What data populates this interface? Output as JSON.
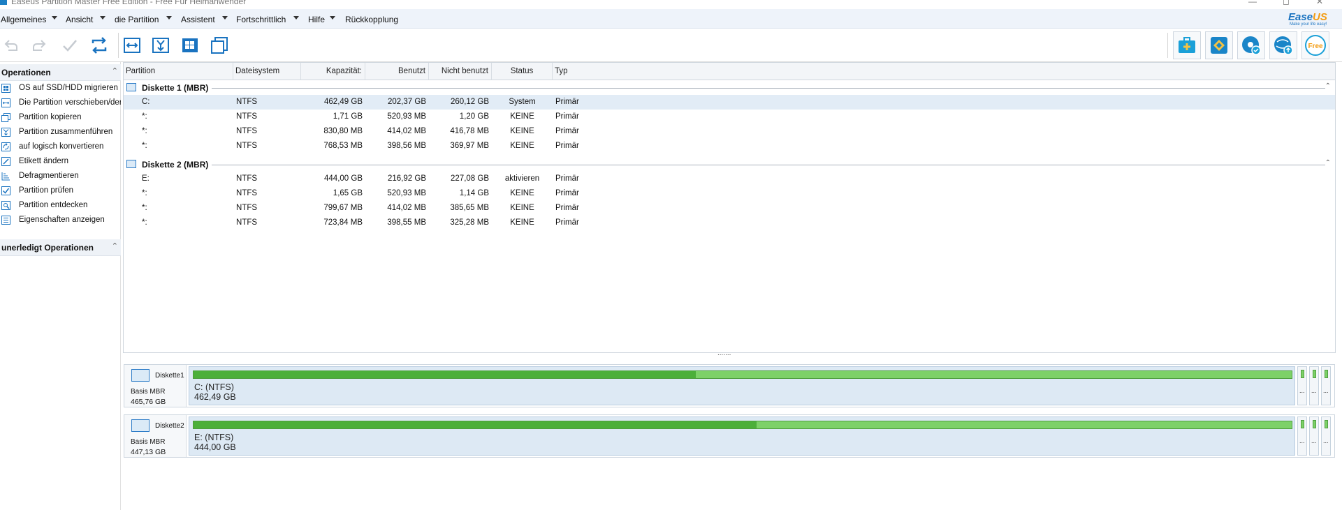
{
  "window": {
    "title": "Easeus Partition Master Free Edition - Free Für Heimanwender",
    "minimize": "—",
    "maximize": "◻",
    "close": "✕"
  },
  "menu": [
    "Allgemeines",
    "Ansicht",
    "die Partition",
    "Assistent",
    "Fortschrittlich",
    "Hilfe",
    "Rückkopplung"
  ],
  "logo": {
    "brand": "Ease",
    "brand_accent": "US",
    "tagline": "Make your life easy!"
  },
  "toolbar": {
    "left_icons": [
      "undo-icon",
      "redo-icon",
      "apply-icon",
      "refresh-icon"
    ],
    "mid_icons": [
      "resize-move-icon",
      "merge-icon",
      "migrate-os-icon",
      "copy-icon"
    ],
    "right_icons": [
      "backup-icon",
      "tag-icon",
      "recovery-icon",
      "update-icon",
      "free-icon"
    ],
    "free_label": "Free"
  },
  "operations": {
    "title": "Operationen",
    "collapse": "⌃",
    "items": [
      {
        "label": "OS auf SSD/HDD migrieren",
        "icon": "migrate-os-icon"
      },
      {
        "label": "Die Partition verschieben/dere",
        "icon": "resize-move-icon"
      },
      {
        "label": "Partition kopieren",
        "icon": "copy-partition-icon"
      },
      {
        "label": "Partition zusammenführen",
        "icon": "merge-partition-icon"
      },
      {
        "label": "auf logisch konvertieren",
        "icon": "convert-logical-icon"
      },
      {
        "label": "Etikett ändern",
        "icon": "edit-label-icon"
      },
      {
        "label": "Defragmentieren",
        "icon": "defragment-icon"
      },
      {
        "label": "Partition prüfen",
        "icon": "check-partition-icon"
      },
      {
        "label": "Partition entdecken",
        "icon": "explore-partition-icon"
      },
      {
        "label": "Eigenschaften anzeigen",
        "icon": "properties-icon"
      }
    ]
  },
  "pending": {
    "title": "unerledigt Operationen",
    "collapse": "⌃"
  },
  "table": {
    "headers": {
      "partition": "Partition",
      "filesystem": "Dateisystem",
      "capacity": "Kapazität:",
      "used": "Benutzt",
      "unused": "Nicht benutzt",
      "status": "Status",
      "type": "Typ"
    },
    "groups": [
      {
        "title": "Diskette 1 (MBR)",
        "collapse": "⌃",
        "rows": [
          {
            "partition": "C:",
            "fs": "NTFS",
            "capacity": "462,49 GB",
            "used": "202,37 GB",
            "unused": "260,12 GB",
            "status": "System",
            "type": "Primär"
          },
          {
            "partition": "*:",
            "fs": "NTFS",
            "capacity": "1,71 GB",
            "used": "520,93 MB",
            "unused": "1,20 GB",
            "status": "KEINE",
            "type": "Primär"
          },
          {
            "partition": "*:",
            "fs": "NTFS",
            "capacity": "830,80 MB",
            "used": "414,02 MB",
            "unused": "416,78 MB",
            "status": "KEINE",
            "type": "Primär"
          },
          {
            "partition": "*:",
            "fs": "NTFS",
            "capacity": "768,53 MB",
            "used": "398,56 MB",
            "unused": "369,97 MB",
            "status": "KEINE",
            "type": "Primär"
          }
        ]
      },
      {
        "title": "Diskette 2 (MBR)",
        "collapse": "⌃",
        "rows": [
          {
            "partition": "E:",
            "fs": "NTFS",
            "capacity": "444,00 GB",
            "used": "216,92 GB",
            "unused": "227,08 GB",
            "status": "aktivieren",
            "type": "Primär"
          },
          {
            "partition": "*:",
            "fs": "NTFS",
            "capacity": "1,65 GB",
            "used": "520,93 MB",
            "unused": "1,14 GB",
            "status": "KEINE",
            "type": "Primär"
          },
          {
            "partition": "*:",
            "fs": "NTFS",
            "capacity": "799,67 MB",
            "used": "414,02 MB",
            "unused": "385,65 MB",
            "status": "KEINE",
            "type": "Primär"
          },
          {
            "partition": "*:",
            "fs": "NTFS",
            "capacity": "723,84 MB",
            "used": "398,55 MB",
            "unused": "325,28 MB",
            "status": "KEINE",
            "type": "Primär"
          }
        ]
      }
    ],
    "splitter": "......."
  },
  "disks": [
    {
      "name": "Diskette1",
      "type": "Basis MBR",
      "size": "465,76 GB",
      "partition_label": "C: (NTFS)",
      "partition_size": "462,49 GB",
      "used_fraction": 0.4575,
      "mini_dots": [
        "...",
        "...",
        "..."
      ]
    },
    {
      "name": "Diskette2",
      "type": "Basis MBR",
      "size": "447,13 GB",
      "partition_label": "E: (NTFS)",
      "partition_size": "444,00 GB",
      "used_fraction": 0.5125,
      "mini_dots": [
        "...",
        "...",
        "..."
      ]
    }
  ],
  "colors": {
    "accent": "#1a73c0",
    "used_bar": "#4caf3a",
    "free_bar": "#7dd168",
    "selected_row": "#e2ecf6",
    "logo_orange": "#f39c12"
  }
}
